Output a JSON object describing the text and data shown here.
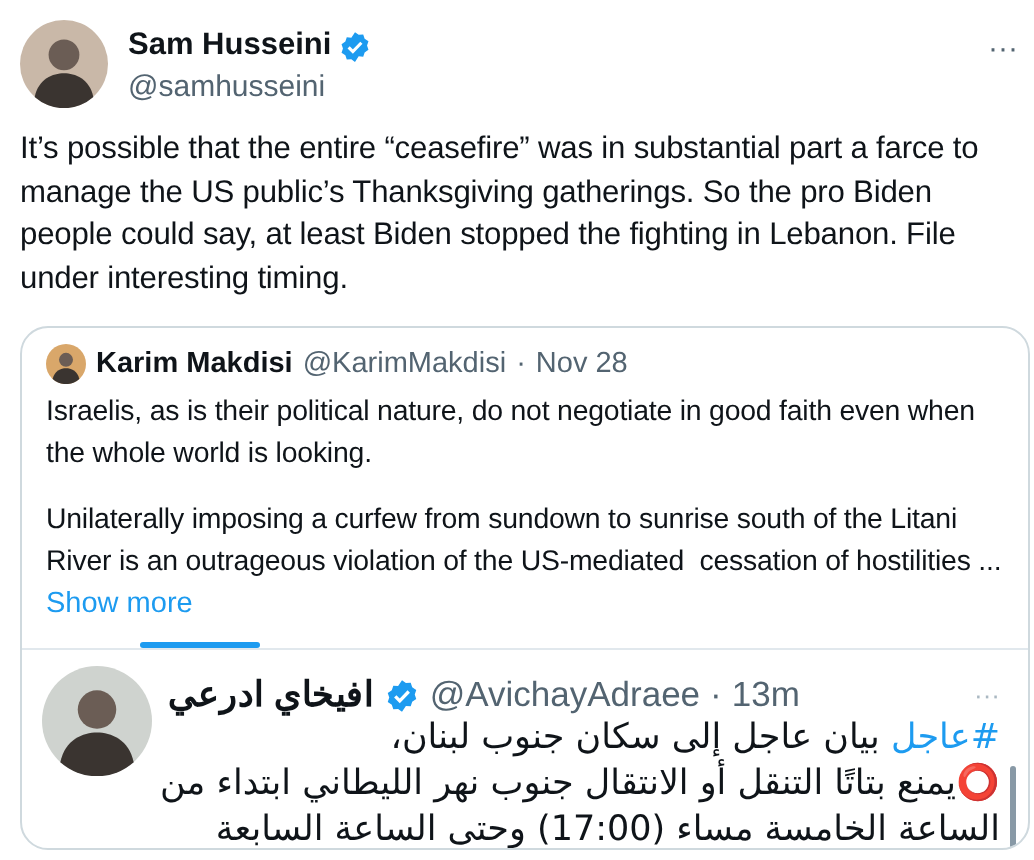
{
  "tweet": {
    "author": {
      "name": "Sam Husseini",
      "verified": true,
      "handle": "@samhusseini"
    },
    "more": "···",
    "text": "It’s possible that the entire “ceasefire” was in substantial part a farce to\nmanage the US public’s Thanksgiving gatherings. So the pro Biden\npeople could say, at least Biden stopped the fighting in Lebanon. File\nunder interesting timing."
  },
  "quote": {
    "author": {
      "name": "Karim Makdisi",
      "handle": "@KarimMakdisi",
      "separator": "·",
      "date": "Nov 28"
    },
    "paragraphs": [
      "Israelis, as is their political nature, do not negotiate in good faith even when\nthe whole world is looking.",
      "Unilaterally imposing a curfew from sundown to sunrise south of the Litani\nRiver is an outrageous violation of the US-mediated  cessation of hostilities ..."
    ],
    "show_more": "Show more",
    "embedded": {
      "author": {
        "name": "افيخاي ادرعي",
        "verified": true,
        "handle": "@AvichayAdraee",
        "separator": "·",
        "time": "13m"
      },
      "more": "···",
      "hashtag": "#عاجل",
      "lines": [
        " بيان عاجل إلى سكان جنوب لبنان،",
        "⭕يمنع بتاتًا التنقل أو الانتقال جنوب نهر الليطاني ابتداء من",
        "الساعة الخامسة مساء (17:00) وحتى الساعة السابعة"
      ]
    }
  }
}
